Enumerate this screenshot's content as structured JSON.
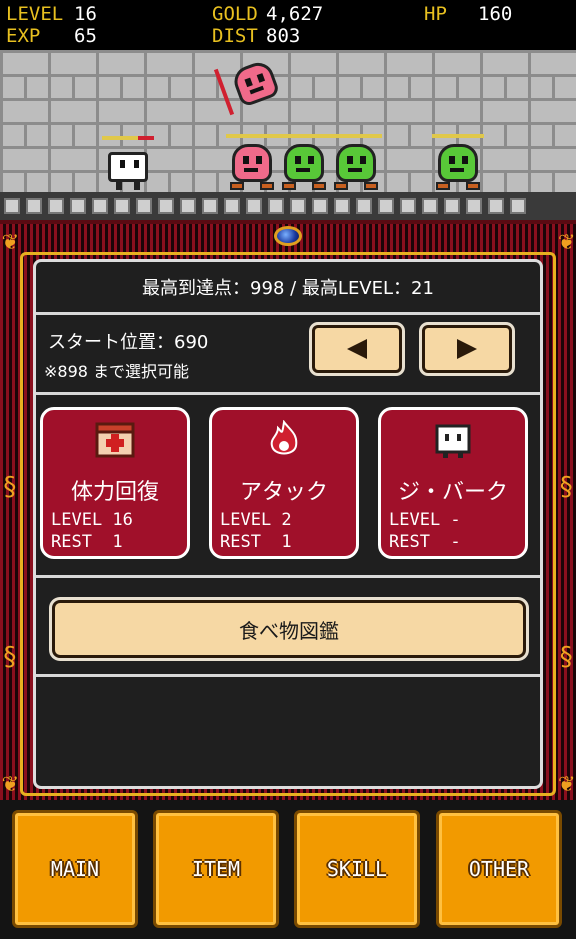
{
  "hud": {
    "level_label": "LEVEL",
    "level_value": "16",
    "exp_label": "EXP",
    "exp_value": "65",
    "gold_label": "GOLD",
    "gold_value": "4,627",
    "dist_label": "DIST",
    "dist_value": "803",
    "hp_label": "HP",
    "hp_value": "160"
  },
  "field": {
    "hero_icon": "hero-character",
    "enemies": [
      "pink-monster",
      "green-monster",
      "green-monster",
      "green-monster",
      "pink-monster-flying"
    ]
  },
  "panel": {
    "best_record": "最高到達点：998 / 最高LEVEL：21",
    "start_position": "スタート位置：690",
    "start_note": "※898 まで選択可能",
    "prev_icon": "arrow-left-icon",
    "next_icon": "arrow-right-icon",
    "cards": [
      {
        "title": "体力回復",
        "level": "LEVEL 16",
        "rest": "REST  1",
        "icon": "medical-box-icon"
      },
      {
        "title": "アタック",
        "level": "LEVEL 2",
        "rest": "REST  1",
        "icon": "fire-icon"
      },
      {
        "title": "ジ・バーク",
        "level": "LEVEL -",
        "rest": "REST  -",
        "icon": "white-creature-icon"
      }
    ],
    "zukan_button": "食べ物図鑑"
  },
  "nav": {
    "main": "MAIN",
    "item": "ITEM",
    "skill": "SKILL",
    "other": "OTHER"
  },
  "colors": {
    "accent_gold": "#e8c020",
    "card_red": "#a0102a",
    "nav_orange": "#f29a00",
    "button_cream": "#f6d8a4"
  }
}
